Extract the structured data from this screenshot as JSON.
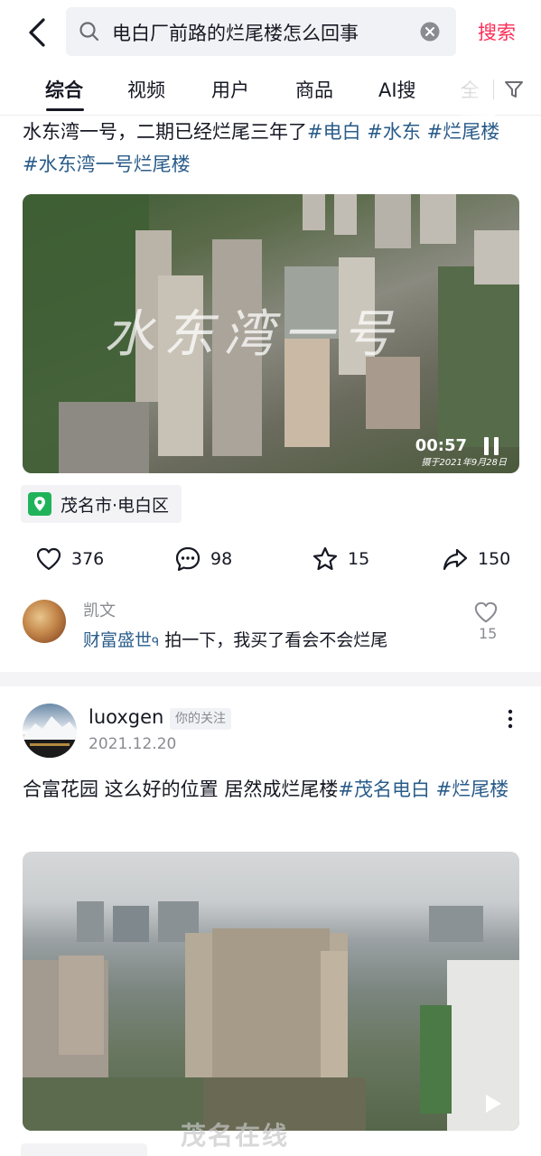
{
  "search": {
    "query": "电白厂前路的烂尾楼怎么回事",
    "button_label": "搜索"
  },
  "tabs": [
    {
      "label": "综合",
      "active": true
    },
    {
      "label": "视频",
      "active": false
    },
    {
      "label": "用户",
      "active": false
    },
    {
      "label": "商品",
      "active": false
    },
    {
      "label": "AI搜",
      "active": false
    },
    {
      "label": "全",
      "active": false
    }
  ],
  "post1": {
    "text_plain": "水东湾一号，二期已经烂尾三年了",
    "hashtags": [
      "#电白",
      "#水东",
      "#烂尾楼",
      "#水东湾一号烂尾楼"
    ],
    "video": {
      "watermark": "水东湾一号",
      "duration": "00:57",
      "stamp": "摄于2021年9月28日"
    },
    "location": "茂名市·电白区",
    "likes": "376",
    "comments": "98",
    "favorites": "15",
    "shares": "150",
    "top_comment": {
      "author": "凯文",
      "mention": "财富盛世",
      "text": "拍一下，我买了看会不会烂尾",
      "likes": "15"
    }
  },
  "post2": {
    "author": "luoxgen",
    "badge": "你的关注",
    "date": "2021.12.20",
    "text_plain": "合富花园  这么好的位置  居然成烂尾楼",
    "hashtags": [
      "#茂名电白",
      "#烂尾楼"
    ],
    "site_watermark": "茂名在线"
  },
  "colors": {
    "accent": "#fe2c55",
    "hashtag": "#2a5c8a",
    "location_green": "#21b35a"
  }
}
